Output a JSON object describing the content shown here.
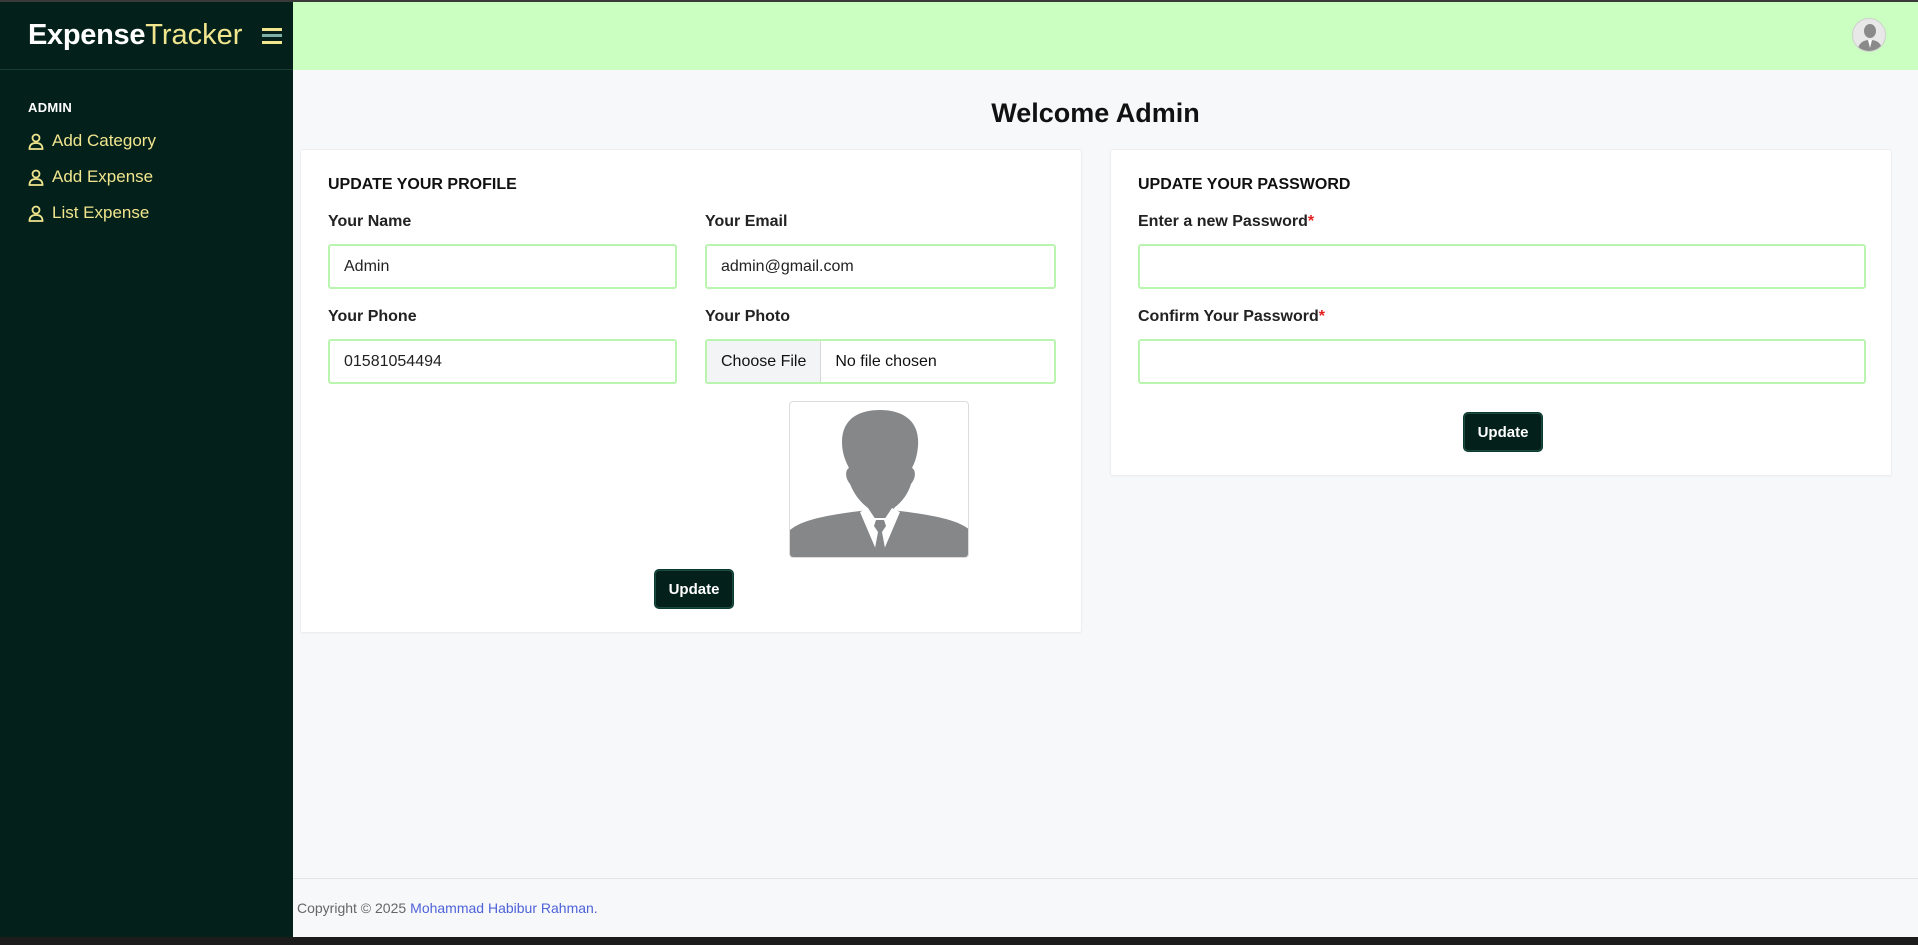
{
  "brand": {
    "name": "Expense",
    "accent": "Tracker"
  },
  "sidebar": {
    "section_title": "ADMIN",
    "items": [
      {
        "label": "Add Category",
        "icon": "user-icon"
      },
      {
        "label": "Add Expense",
        "icon": "user-icon"
      },
      {
        "label": "List Expense",
        "icon": "user-icon"
      }
    ]
  },
  "header": {
    "avatar_icon": "user-avatar-icon"
  },
  "page": {
    "title": "Welcome Admin"
  },
  "profile_form": {
    "title": "UPDATE YOUR PROFILE",
    "name_label": "Your Name",
    "name_value": "Admin",
    "email_label": "Your Email",
    "email_value": "admin@gmail.com",
    "phone_label": "Your Phone",
    "phone_value": "01581054494",
    "photo_label": "Your Photo",
    "file_button": "Choose File",
    "file_status": "No file chosen",
    "submit_label": "Update"
  },
  "password_form": {
    "title": "UPDATE YOUR PASSWORD",
    "new_label": "Enter a new Password",
    "confirm_label": "Confirm Your Password",
    "required_mark": "*",
    "new_value": "",
    "confirm_value": "",
    "submit_label": "Update"
  },
  "footer": {
    "copyright": "Copyright © 2025",
    "author": "Mohammad Habibur Rahman."
  },
  "colors": {
    "sidebar_bg": "#03201a",
    "topbar_bg": "#caffc1",
    "accent_yellow": "#f1e58e",
    "input_border": "#baf5b0",
    "link": "#4f63d9"
  }
}
